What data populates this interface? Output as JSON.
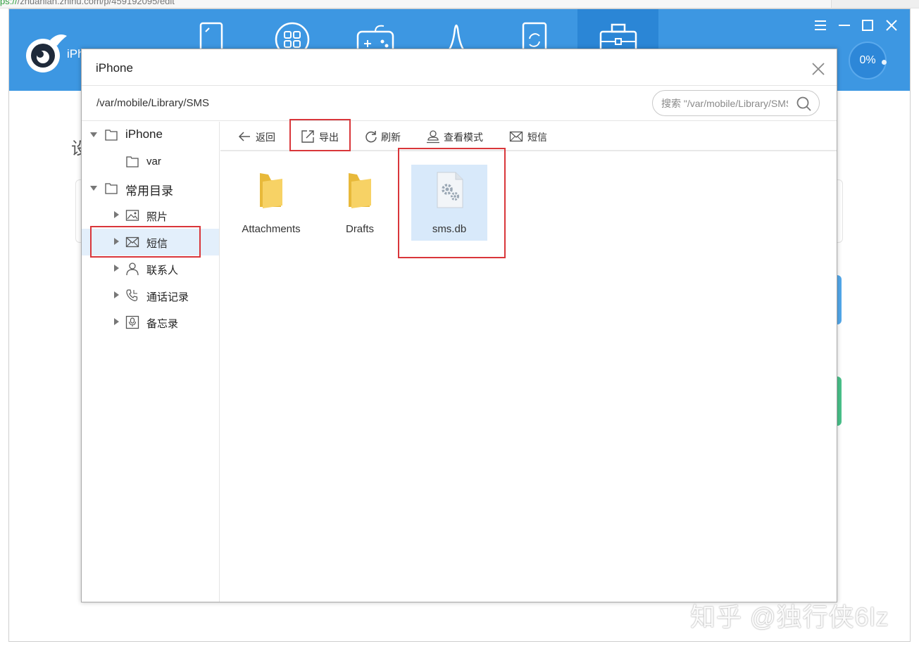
{
  "browser": {
    "url_scheme": "ps://",
    "url_rest": "/zhuanlan.zhihu.com/p/459192095/edit"
  },
  "app": {
    "name": "iPh",
    "progress": "0%",
    "accent_color": "#3d97e2",
    "nav_icons": [
      "phone-icon",
      "apps-icon",
      "gamepad-icon",
      "ringtone-icon",
      "sync-icon",
      "toolbox-icon"
    ],
    "bg_char": "设"
  },
  "dialog": {
    "title": "iPhone",
    "path": "/var/mobile/Library/SMS",
    "search": {
      "placeholder": "搜索 \"/var/mobile/Library/SMS\""
    }
  },
  "tree": {
    "root": "iPhone",
    "var": "var",
    "common": "常用目录",
    "photos": "照片",
    "sms": "短信",
    "contacts": "联系人",
    "calls": "通话记录",
    "notes": "备忘录"
  },
  "toolbar": {
    "back": "返回",
    "export": "导出",
    "refresh": "刷新",
    "view_mode": "查看模式",
    "sms": "短信"
  },
  "files": [
    {
      "name": "Attachments",
      "type": "folder"
    },
    {
      "name": "Drafts",
      "type": "folder"
    },
    {
      "name": "sms.db",
      "type": "database-file"
    }
  ],
  "highlight_color": "#d9363a",
  "watermark": "知乎 @独行侠6lz"
}
